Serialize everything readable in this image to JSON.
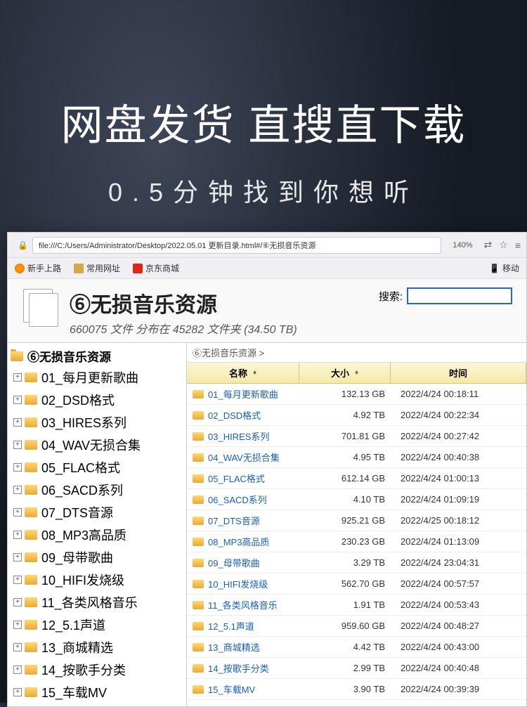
{
  "promo": {
    "title": "网盘发货 直搜直下载",
    "subtitle": "0.5分钟找到你想听"
  },
  "browser": {
    "url": "file:///C:/Users/Administrator/Desktop/2022.05.01 更新目录.html#/⑥无损音乐资源",
    "zoom": "140%",
    "bookmarks": {
      "newbie": "新手上路",
      "common": "常用网址",
      "jd": "京东商城",
      "mobile": "移动"
    }
  },
  "page": {
    "title": "⑥无损音乐资源",
    "stats": "660075 文件 分布在 45282 文件夹 (34.50 TB)",
    "search_label": "搜索:",
    "breadcrumb": "⑥无损音乐资源 >"
  },
  "tree": {
    "root": "⑥无损音乐资源",
    "items": [
      "01_每月更新歌曲",
      "02_DSD格式",
      "03_HIRES系列",
      "04_WAV无损合集",
      "05_FLAC格式",
      "06_SACD系列",
      "07_DTS音源",
      "08_MP3高品质",
      "09_母带歌曲",
      "10_HIFI发烧级",
      "11_各类风格音乐",
      "12_5.1声道",
      "13_商城精选",
      "14_按歌手分类",
      "15_车载MV"
    ]
  },
  "table": {
    "headers": {
      "name": "名称",
      "size": "大小",
      "time": "时间"
    },
    "rows": [
      {
        "name": "01_每月更新歌曲",
        "size": "132.13 GB",
        "time": "2022/4/24 00:18:11"
      },
      {
        "name": "02_DSD格式",
        "size": "4.92 TB",
        "time": "2022/4/24 00:22:34"
      },
      {
        "name": "03_HIRES系列",
        "size": "701.81 GB",
        "time": "2022/4/24 00:27:42"
      },
      {
        "name": "04_WAV无损合集",
        "size": "4.95 TB",
        "time": "2022/4/24 00:40:38"
      },
      {
        "name": "05_FLAC格式",
        "size": "612.14 GB",
        "time": "2022/4/24 01:00:13"
      },
      {
        "name": "06_SACD系列",
        "size": "4.10 TB",
        "time": "2022/4/24 01:09:19"
      },
      {
        "name": "07_DTS音源",
        "size": "925.21 GB",
        "time": "2022/4/25 00:18:12"
      },
      {
        "name": "08_MP3高品质",
        "size": "230.23 GB",
        "time": "2022/4/24 01:13:09"
      },
      {
        "name": "09_母带歌曲",
        "size": "3.29 TB",
        "time": "2022/4/24 23:04:31"
      },
      {
        "name": "10_HIFI发烧级",
        "size": "562.70 GB",
        "time": "2022/4/24 00:57:57"
      },
      {
        "name": "11_各类风格音乐",
        "size": "1.91 TB",
        "time": "2022/4/24 00:53:43"
      },
      {
        "name": "12_5.1声道",
        "size": "959.60 GB",
        "time": "2022/4/24 00:48:27"
      },
      {
        "name": "13_商城精选",
        "size": "4.42 TB",
        "time": "2022/4/24 00:43:00"
      },
      {
        "name": "14_按歌手分类",
        "size": "2.99 TB",
        "time": "2022/4/24 00:40:48"
      },
      {
        "name": "15_车载MV",
        "size": "3.90 TB",
        "time": "2022/4/24 00:39:39"
      }
    ]
  }
}
